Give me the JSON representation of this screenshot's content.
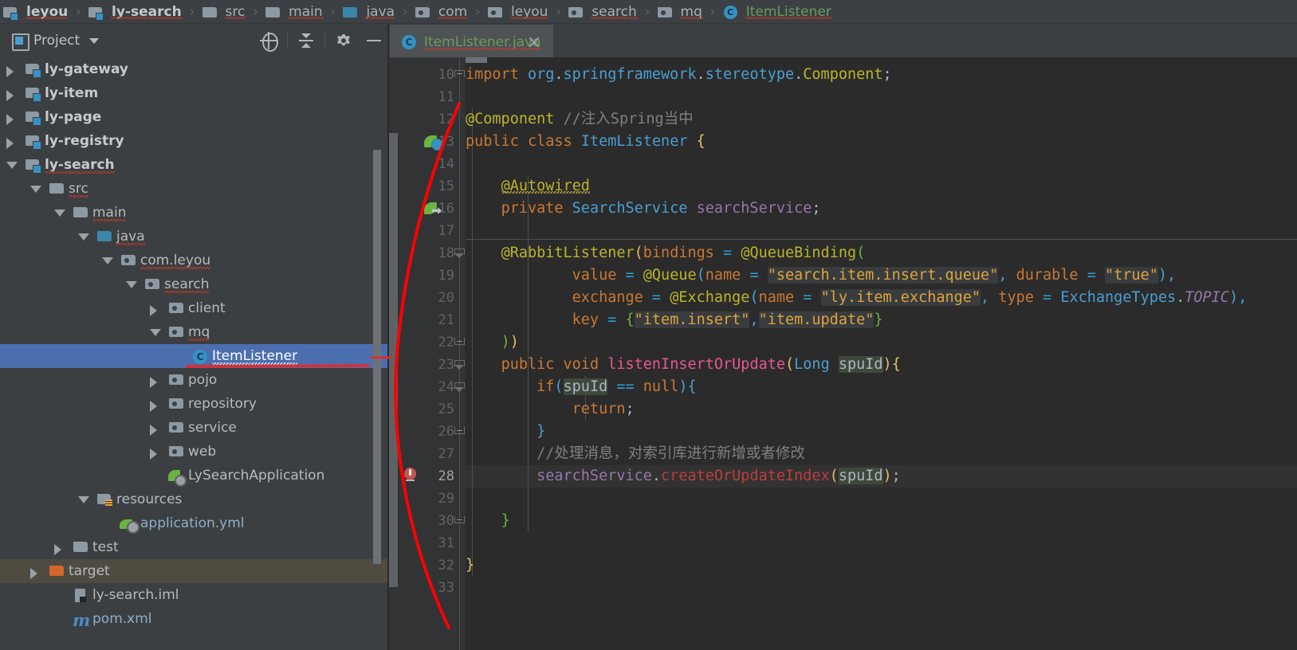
{
  "breadcrumb": {
    "items": [
      {
        "label": "leyou",
        "icon": "module-folder-icon",
        "style": "bold"
      },
      {
        "label": "ly-search",
        "icon": "module-folder-icon",
        "style": "bold"
      },
      {
        "label": "src",
        "icon": "folder-icon",
        "style": "normal"
      },
      {
        "label": "main",
        "icon": "folder-icon",
        "style": "normal"
      },
      {
        "label": "java",
        "icon": "source-folder-icon",
        "style": "normal"
      },
      {
        "label": "com",
        "icon": "package-icon",
        "style": "normal"
      },
      {
        "label": "leyou",
        "icon": "package-icon",
        "style": "normal"
      },
      {
        "label": "search",
        "icon": "package-icon",
        "style": "normal"
      },
      {
        "label": "mq",
        "icon": "package-icon",
        "style": "normal"
      },
      {
        "label": "ItemListener",
        "icon": "java-class-icon",
        "style": "class"
      }
    ],
    "separator": "›"
  },
  "project_panel": {
    "title": "Project",
    "dropdown_caret": "▼",
    "toolbar": [
      {
        "name": "locate-in-tree-button",
        "label": "Select Opened File"
      },
      {
        "name": "collapse-all-button",
        "label": "Collapse All"
      },
      {
        "name": "settings-gear-button",
        "label": "Settings"
      },
      {
        "name": "hide-panel-button",
        "label": "Hide"
      }
    ],
    "tree": [
      {
        "label": "ly-gateway",
        "depth": 1,
        "arrow": "collapsed",
        "icon": "module-folder-icon",
        "style": "bold"
      },
      {
        "label": "ly-item",
        "depth": 1,
        "arrow": "collapsed",
        "icon": "module-folder-icon",
        "style": "bold"
      },
      {
        "label": "ly-page",
        "depth": 1,
        "arrow": "collapsed",
        "icon": "module-folder-icon",
        "style": "bold"
      },
      {
        "label": "ly-registry",
        "depth": 1,
        "arrow": "collapsed",
        "icon": "module-folder-icon",
        "style": "bold"
      },
      {
        "label": "ly-search",
        "depth": 1,
        "arrow": "expanded",
        "icon": "module-folder-icon",
        "style": "bold",
        "spellcheck": true
      },
      {
        "label": "src",
        "depth": 2,
        "arrow": "expanded",
        "icon": "folder-icon",
        "style": "normal",
        "spellcheck": true
      },
      {
        "label": "main",
        "depth": 3,
        "arrow": "expanded",
        "icon": "folder-icon",
        "style": "normal",
        "spellcheck": true
      },
      {
        "label": "java",
        "depth": 4,
        "arrow": "expanded",
        "icon": "source-folder-icon",
        "style": "normal",
        "spellcheck": true
      },
      {
        "label": "com.leyou",
        "depth": 5,
        "arrow": "expanded",
        "icon": "package-icon",
        "style": "normal",
        "spellcheck": true
      },
      {
        "label": "search",
        "depth": 6,
        "arrow": "expanded",
        "icon": "package-icon",
        "style": "normal",
        "spellcheck": true
      },
      {
        "label": "client",
        "depth": 7,
        "arrow": "collapsed",
        "icon": "package-icon",
        "style": "normal"
      },
      {
        "label": "mq",
        "depth": 7,
        "arrow": "expanded",
        "icon": "package-icon",
        "style": "normal",
        "spellcheck": true
      },
      {
        "label": "ItemListener",
        "depth": 8,
        "arrow": "none",
        "icon": "java-class-icon",
        "style": "normal",
        "selected": true,
        "spellcheck": true
      },
      {
        "label": "pojo",
        "depth": 7,
        "arrow": "collapsed",
        "icon": "package-icon",
        "style": "normal"
      },
      {
        "label": "repository",
        "depth": 7,
        "arrow": "collapsed",
        "icon": "package-icon",
        "style": "normal"
      },
      {
        "label": "service",
        "depth": 7,
        "arrow": "collapsed",
        "icon": "package-icon",
        "style": "normal"
      },
      {
        "label": "web",
        "depth": 7,
        "arrow": "collapsed",
        "icon": "package-icon",
        "style": "normal"
      },
      {
        "label": "LySearchApplication",
        "depth": 7,
        "arrow": "none",
        "icon": "spring-boot-class-icon",
        "style": "normal"
      },
      {
        "label": "resources",
        "depth": 4,
        "arrow": "expanded",
        "icon": "resources-folder-icon",
        "style": "normal"
      },
      {
        "label": "application.yml",
        "depth": 5,
        "arrow": "none",
        "icon": "spring-yaml-icon",
        "style": "link"
      },
      {
        "label": "test",
        "depth": 3,
        "arrow": "collapsed",
        "icon": "folder-icon",
        "style": "normal"
      },
      {
        "label": "target",
        "depth": 2,
        "arrow": "collapsed",
        "icon": "excluded-folder-icon",
        "style": "normal",
        "highlight": "target"
      },
      {
        "label": "ly-search.iml",
        "depth": 3,
        "arrow": "none",
        "icon": "iml-file-icon",
        "style": "normal"
      },
      {
        "label": "pom.xml",
        "depth": 3,
        "arrow": "none",
        "icon": "maven-icon",
        "style": "link"
      }
    ]
  },
  "editor": {
    "tab": {
      "label": "ItemListener.java",
      "icon": "java-class-icon",
      "close_icon": "close-icon",
      "active": true
    },
    "current_line": 28,
    "first_visible_line": 10,
    "last_visible_line": 33,
    "lines": [
      {
        "num": 10,
        "text": "import org.springframework.stereotype.Component;"
      },
      {
        "num": 11,
        "text": ""
      },
      {
        "num": 12,
        "text": "@Component //注入Spring当中"
      },
      {
        "num": 13,
        "text": "public class ItemListener {",
        "gutter_icon": "spring-bean-icon"
      },
      {
        "num": 14,
        "text": ""
      },
      {
        "num": 15,
        "text": "    @Autowired"
      },
      {
        "num": 16,
        "text": "    private SearchService searchService;",
        "gutter_icon": "spring-autowired-icon"
      },
      {
        "num": 17,
        "text": ""
      },
      {
        "num": 18,
        "text": "    @RabbitListener(bindings = @QueueBinding("
      },
      {
        "num": 19,
        "text": "            value = @Queue(name = \"search.item.insert.queue\", durable = \"true\"),"
      },
      {
        "num": 20,
        "text": "            exchange = @Exchange(name = \"ly.item.exchange\", type = ExchangeTypes.TOPIC),"
      },
      {
        "num": 21,
        "text": "            key = {\"item.insert\",\"item.update\"}"
      },
      {
        "num": 22,
        "text": "    ))"
      },
      {
        "num": 23,
        "text": "    public void listenInsertOrUpdate(Long spuId){"
      },
      {
        "num": 24,
        "text": "        if(spuId == null){"
      },
      {
        "num": 25,
        "text": "            return;"
      },
      {
        "num": 26,
        "text": "        }"
      },
      {
        "num": 27,
        "text": "        //处理消息，对索引库进行新增或者修改"
      },
      {
        "num": 28,
        "text": "        searchService.createOrUpdateIndex(spuId);",
        "gutter_icon": "error-bulb-icon"
      },
      {
        "num": 29,
        "text": ""
      },
      {
        "num": 30,
        "text": "    }"
      },
      {
        "num": 31,
        "text": ""
      },
      {
        "num": 32,
        "text": "}"
      },
      {
        "num": 33,
        "text": ""
      }
    ]
  },
  "annotation": {
    "name": "red-pen-curve",
    "color": "#ff0000",
    "underline_color": "#e03030"
  },
  "colors": {
    "editor_bg": "#2b2b2b",
    "gutter_bg": "#313335",
    "panel_bg": "#3c3f41",
    "selection_blue": "#4b6eaf",
    "excluded_olive": "#4f4b41",
    "accent_blue": "#3592c4",
    "spring_green": "#6cb33f"
  }
}
